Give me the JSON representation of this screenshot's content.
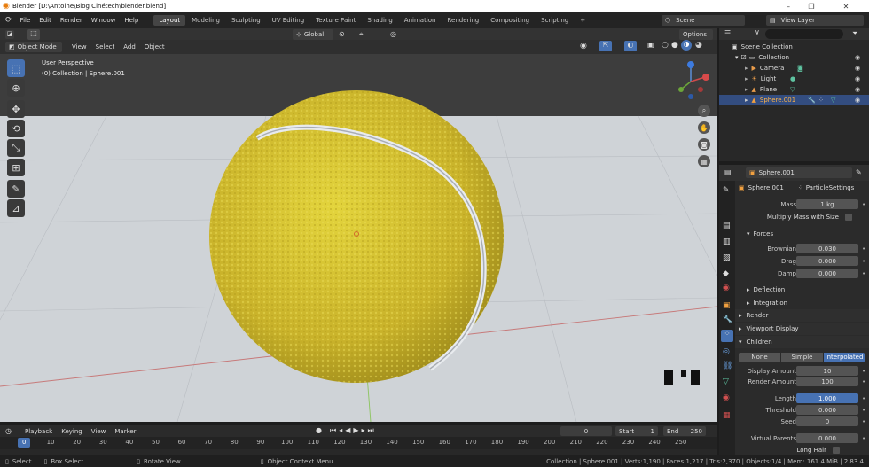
{
  "window": {
    "title": "Blender [D:\\Antoine\\Blog Cinétech\\blender.blend]",
    "minimize": "–",
    "maximize": "❐",
    "close": "✕"
  },
  "menu": {
    "items": [
      "File",
      "Edit",
      "Render",
      "Window",
      "Help"
    ]
  },
  "workspaces": {
    "tabs": [
      "Layout",
      "Modeling",
      "Sculpting",
      "UV Editing",
      "Texture Paint",
      "Shading",
      "Animation",
      "Rendering",
      "Compositing",
      "Scripting"
    ],
    "active": "Layout",
    "add": "+"
  },
  "scene": {
    "name": "Scene",
    "view_layer": "View Layer"
  },
  "viewport_header": {
    "transform_orientation": "Global",
    "options": "Options",
    "mode": "Object Mode",
    "menus": [
      "View",
      "Select",
      "Add",
      "Object"
    ]
  },
  "viewport": {
    "perspective": "User Perspective",
    "collection_info": "(0) Collection | Sphere.001"
  },
  "timeline": {
    "menus": [
      "Playback",
      "Keying",
      "View",
      "Marker"
    ],
    "current_frame": "0",
    "start_label": "Start",
    "start": "1",
    "end_label": "End",
    "end": "250",
    "ticks": [
      "0",
      "10",
      "20",
      "30",
      "40",
      "50",
      "60",
      "70",
      "80",
      "90",
      "100",
      "110",
      "120",
      "130",
      "140",
      "150",
      "160",
      "170",
      "180",
      "190",
      "200",
      "210",
      "220",
      "230",
      "240",
      "250"
    ]
  },
  "status": {
    "select": "Select",
    "box_select": "Box Select",
    "rotate_view": "Rotate View",
    "context_menu": "Object Context Menu",
    "stats": "Collection | Sphere.001 | Verts:1,190 | Faces:1,217 | Tris:2,370 | Objects:1/4 | Mem: 161.4 MiB | 2.83.4"
  },
  "outliner": {
    "root": "Scene Collection",
    "collection": "Collection",
    "items": [
      {
        "name": "Camera",
        "icon": "camera-icon"
      },
      {
        "name": "Light",
        "icon": "light-icon"
      },
      {
        "name": "Plane",
        "icon": "mesh-icon"
      },
      {
        "name": "Sphere.001",
        "icon": "mesh-icon"
      }
    ]
  },
  "properties": {
    "object_name": "Sphere.001",
    "breadcrumb_object": "Sphere.001",
    "breadcrumb_settings": "ParticleSettings",
    "mass_label": "Mass",
    "mass": "1 kg",
    "multiply_mass": "Multiply Mass with Size",
    "forces_label": "Forces",
    "brownian_label": "Brownian",
    "brownian": "0.030",
    "drag_label": "Drag",
    "drag": "0.000",
    "damp_label": "Damp",
    "damp": "0.000",
    "deflection_label": "Deflection",
    "integration_label": "Integration",
    "render_label": "Render",
    "viewport_display_label": "Viewport Display",
    "children_label": "Children",
    "children_modes": [
      "None",
      "Simple",
      "Interpolated"
    ],
    "children_active": "Interpolated",
    "display_amount_label": "Display Amount",
    "display_amount": "10",
    "render_amount_label": "Render Amount",
    "render_amount": "100",
    "length_label": "Length",
    "length": "1.000",
    "threshold_label": "Threshold",
    "threshold": "0.000",
    "seed_label": "Seed",
    "seed": "0",
    "virtual_parents_label": "Virtual Parents",
    "virtual_parents": "0.000",
    "long_hair_label": "Long Hair"
  },
  "colors": {
    "accent": "#4772b3",
    "ball": "#d6c430",
    "floor": "#cfd3d7"
  }
}
